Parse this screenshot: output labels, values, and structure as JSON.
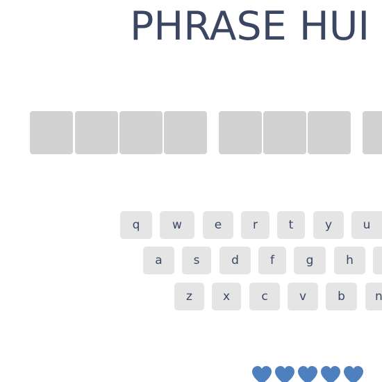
{
  "header": {
    "title": "PHRASE HUI"
  },
  "phrase": {
    "words": [
      {
        "letters": [
          "",
          "",
          "",
          ""
        ]
      },
      {
        "letters": [
          "",
          "",
          ""
        ]
      },
      {
        "letters": [
          ""
        ]
      }
    ]
  },
  "keyboard": {
    "rows": [
      [
        "q",
        "w",
        "e",
        "r",
        "t",
        "y",
        "u"
      ],
      [
        "a",
        "s",
        "d",
        "f",
        "g",
        "h",
        ""
      ],
      [
        "z",
        "x",
        "c",
        "v",
        "b",
        "n"
      ]
    ]
  },
  "lives": {
    "count": 5,
    "icon": "heart-icon",
    "color": "#4e80bf"
  }
}
